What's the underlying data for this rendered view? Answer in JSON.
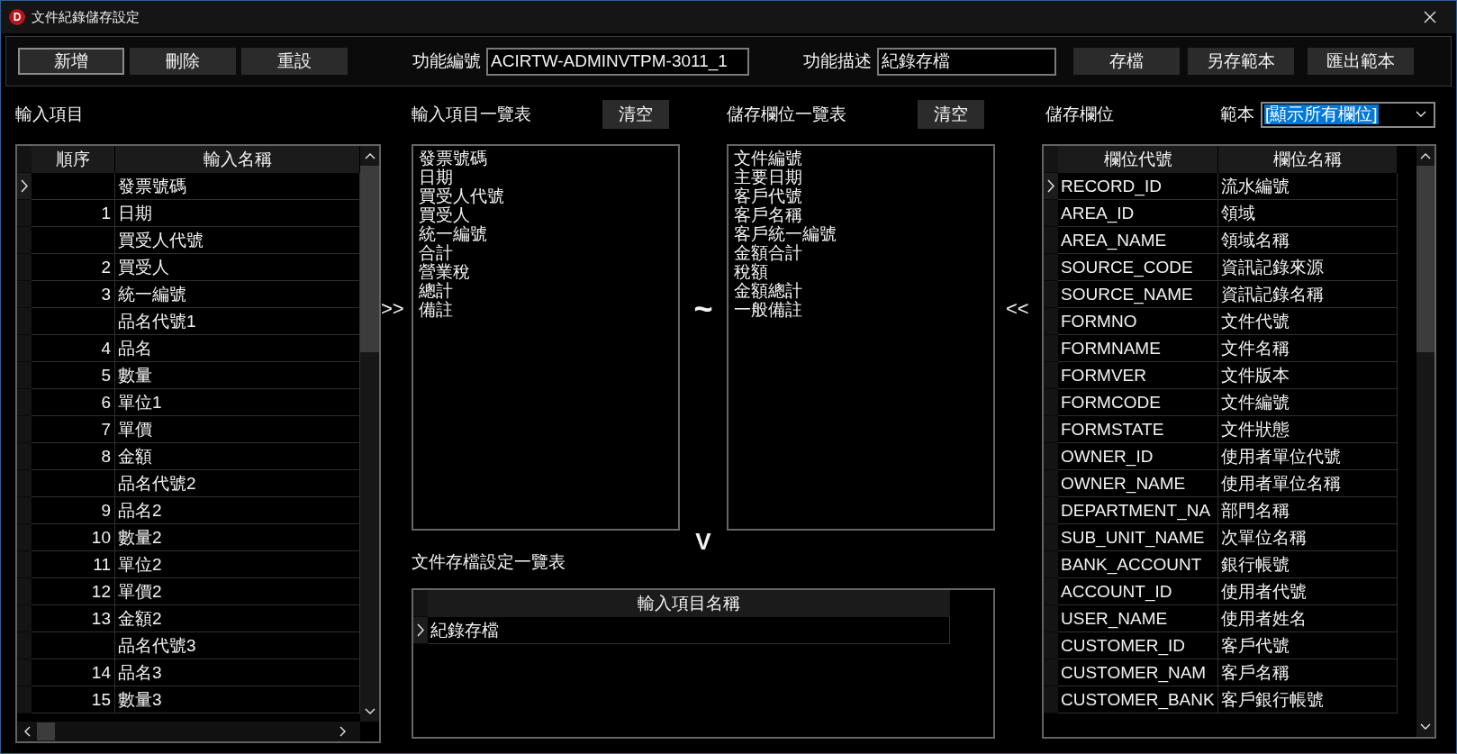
{
  "window": {
    "logo_letter": "D",
    "title": "文件紀錄儲存設定"
  },
  "toolbar": {
    "buttons_left": [
      {
        "label": "新增",
        "focused": true
      },
      {
        "label": "刪除",
        "focused": false
      },
      {
        "label": "重設",
        "focused": false
      }
    ],
    "function_code": {
      "label": "功能編號",
      "value": "ACIRTW-ADMINVTPM-3011_1"
    },
    "function_description": {
      "label": "功能描述",
      "value": "紀錄存檔"
    },
    "buttons_right": [
      {
        "label": "存檔",
        "focused": false
      },
      {
        "label": "另存範本",
        "focused": false
      },
      {
        "label": "匯出範本",
        "focused": false
      }
    ]
  },
  "input_items": {
    "title": "輸入項目",
    "columns": [
      "順序",
      "輸入名稱"
    ],
    "rows": [
      {
        "name": "發票號碼",
        "selected": true
      },
      {
        "order": "1",
        "name": "日期",
        "selected": false
      },
      {
        "name": "買受人代號",
        "selected": false
      },
      {
        "order": "2",
        "name": "買受人",
        "selected": false
      },
      {
        "order": "3",
        "name": "統一編號",
        "selected": false
      },
      {
        "name": "品名代號1",
        "selected": false
      },
      {
        "order": "4",
        "name": "品名",
        "selected": false
      },
      {
        "order": "5",
        "name": "數量",
        "selected": false
      },
      {
        "order": "6",
        "name": "單位1",
        "selected": false
      },
      {
        "order": "7",
        "name": "單價",
        "selected": false
      },
      {
        "order": "8",
        "name": "金額",
        "selected": false
      },
      {
        "name": "品名代號2",
        "selected": false
      },
      {
        "order": "9",
        "name": "品名2",
        "selected": false
      },
      {
        "order": "10",
        "name": "數量2",
        "selected": false
      },
      {
        "order": "11",
        "name": "單位2",
        "selected": false
      },
      {
        "order": "12",
        "name": "單價2",
        "selected": false
      },
      {
        "order": "13",
        "name": "金額2",
        "selected": false
      },
      {
        "name": "品名代號3",
        "selected": false
      },
      {
        "order": "14",
        "name": "品名3",
        "selected": false
      },
      {
        "order": "15",
        "name": "數量3",
        "selected": false
      }
    ]
  },
  "input_item_list": {
    "title": "輸入項目一覽表",
    "clear_button": "清空",
    "items": [
      "發票號碼",
      "日期",
      "買受人代號",
      "買受人",
      "統一編號",
      "合計",
      "營業稅",
      "總計",
      "備註"
    ]
  },
  "move_right": ">>",
  "mapping_symbol": "~",
  "storage_field_list": {
    "title": "儲存欄位一覽表",
    "clear_button": "清空",
    "items": [
      "文件編號",
      "主要日期",
      "客戶代號",
      "客戶名稱",
      "客戶統一編號",
      "金額合計",
      "稅額",
      "金額總計",
      "一般備註"
    ]
  },
  "move_left": "<<",
  "move_down": "V",
  "save_settings": {
    "title": "文件存檔設定一覽表",
    "columns": [
      "輸入項目名稱"
    ],
    "rows": [
      {
        "name": "紀錄存檔",
        "selected": true
      }
    ]
  },
  "storage_fields": {
    "title": "儲存欄位",
    "template": {
      "label": "範本",
      "value": "[顯示所有欄位]",
      "focused": true
    },
    "columns": [
      "欄位代號",
      "欄位名稱"
    ],
    "rows": [
      {
        "code": "RECORD_ID",
        "name": "流水編號",
        "selected": true
      },
      {
        "code": "AREA_ID",
        "name": "領域",
        "selected": false
      },
      {
        "code": "AREA_NAME",
        "name": "領域名稱",
        "selected": false
      },
      {
        "code": "SOURCE_CODE",
        "name": "資訊記錄來源",
        "selected": false
      },
      {
        "code": "SOURCE_NAME",
        "name": "資訊記錄名稱",
        "selected": false
      },
      {
        "code": "FORMNO",
        "name": "文件代號",
        "selected": false
      },
      {
        "code": "FORMNAME",
        "name": "文件名稱",
        "selected": false
      },
      {
        "code": "FORMVER",
        "name": "文件版本",
        "selected": false
      },
      {
        "code": "FORMCODE",
        "name": "文件編號",
        "selected": false
      },
      {
        "code": "FORMSTATE",
        "name": "文件狀態",
        "selected": false
      },
      {
        "code": "OWNER_ID",
        "name": "使用者單位代號",
        "selected": false
      },
      {
        "code": "OWNER_NAME",
        "name": "使用者單位名稱",
        "selected": false
      },
      {
        "code": "DEPARTMENT_NA",
        "name": "部門名稱",
        "selected": false
      },
      {
        "code": "SUB_UNIT_NAME",
        "name": "次單位名稱",
        "selected": false
      },
      {
        "code": "BANK_ACCOUNT",
        "name": "銀行帳號",
        "selected": false
      },
      {
        "code": "ACCOUNT_ID",
        "name": "使用者代號",
        "selected": false
      },
      {
        "code": "USER_NAME",
        "name": "使用者姓名",
        "selected": false
      },
      {
        "code": "CUSTOMER_ID",
        "name": "客戶代號",
        "selected": false
      },
      {
        "code": "CUSTOMER_NAM",
        "name": "客戶名稱",
        "selected": false
      },
      {
        "code": "CUSTOMER_BANK",
        "name": "客戶銀行帳號",
        "selected": false
      }
    ]
  }
}
